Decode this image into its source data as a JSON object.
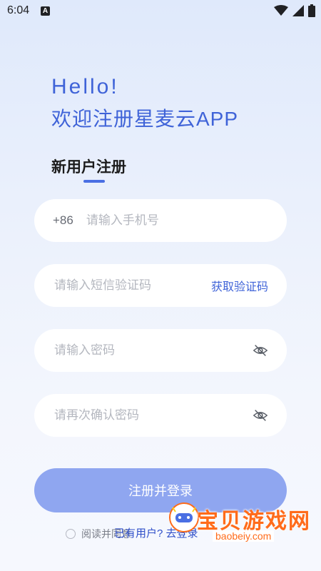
{
  "status_bar": {
    "time": "6:04",
    "notification_icon": "A"
  },
  "header": {
    "hello": "Hello!",
    "welcome": "欢迎注册星麦云APP"
  },
  "section": {
    "title": "新用户注册"
  },
  "phone": {
    "prefix": "+86",
    "placeholder": "请输入手机号"
  },
  "sms": {
    "placeholder": "请输入短信验证码",
    "get_code_label": "获取验证码"
  },
  "password": {
    "placeholder": "请输入密码"
  },
  "confirm_password": {
    "placeholder": "请再次确认密码"
  },
  "submit": {
    "label": "注册并登录"
  },
  "agreement": {
    "text": "阅读并同意"
  },
  "login": {
    "text": "已有用户? 去登录"
  },
  "watermark": {
    "text": "宝贝游戏网",
    "url": "baobeiy.com"
  },
  "colors": {
    "accent": "#3f63d8",
    "button": "#8fa6f0",
    "watermark": "#ff6b1a"
  }
}
